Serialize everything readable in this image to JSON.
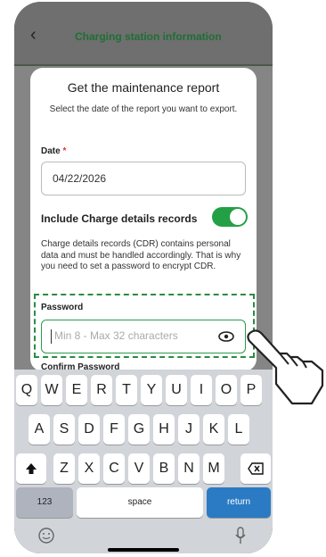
{
  "header": {
    "back_icon": "chevron-left-icon",
    "title": "Charging station information"
  },
  "modal": {
    "title": "Get the maintenance report",
    "subtitle": "Select the date of the report you want to export.",
    "date_label": "Date",
    "date_required": "*",
    "date_value": "04/22/2026",
    "cdr_label": "Include Charge details records",
    "cdr_enabled": true,
    "cdr_description": "Charge details records (CDR) contains personal data and must be handled accordingly. That is why you need to set a password to encrypt CDR.",
    "password_label": "Password",
    "password_placeholder": "Min 8 - Max 32 characters",
    "confirm_label": "Confirm Password"
  },
  "keyboard": {
    "row1": [
      "Q",
      "W",
      "E",
      "R",
      "T",
      "Y",
      "U",
      "I",
      "O",
      "P"
    ],
    "row2": [
      "A",
      "S",
      "D",
      "F",
      "G",
      "H",
      "J",
      "K",
      "L"
    ],
    "row3": [
      "Z",
      "X",
      "C",
      "V",
      "B",
      "N",
      "M"
    ],
    "numbers": "123",
    "space": "space",
    "return": "return"
  },
  "colors": {
    "accent": "#23a046",
    "dash": "#2a8c45",
    "return_key": "#2a7bc4"
  }
}
